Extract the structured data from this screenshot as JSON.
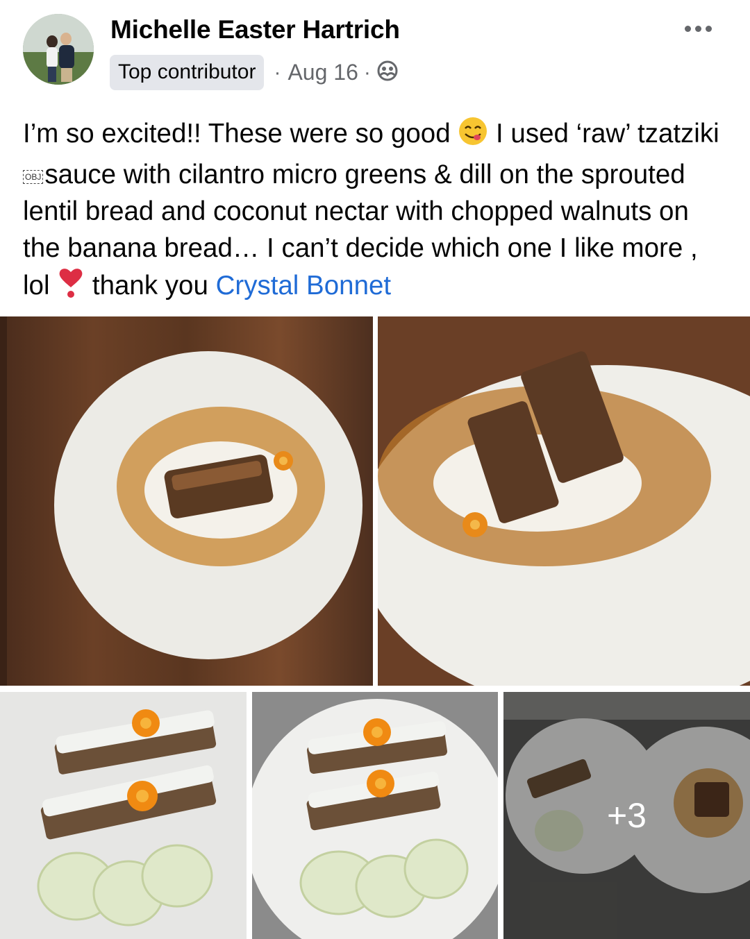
{
  "post": {
    "author": "Michelle Easter Hartrich",
    "badge": "Top contributor",
    "separator": "·",
    "date": "Aug 16",
    "text_parts": [
      "I’m so excited!! These were so good ",
      " I used ‘raw’ tzatziki ",
      "sauce with cilantro micro greens & dill on the sprouted lentil bread and coconut nectar with chopped walnuts on the banana bread… I can’t decide which one I like more , lol ",
      " thank you "
    ],
    "obj_label": "OBJ",
    "mention": "Crystal Bonnet"
  },
  "icons": {
    "more": "more-options-icon",
    "audience": "friends-audience-icon",
    "emoji_yum": "face-savoring-food-emoji",
    "emoji_heart": "heavy-exclamation-heart-emoji"
  },
  "photos": {
    "more_count": "+3"
  },
  "colors": {
    "link": "#1f6bd6",
    "meta": "#65676b",
    "badge_bg": "#e4e6eb"
  }
}
